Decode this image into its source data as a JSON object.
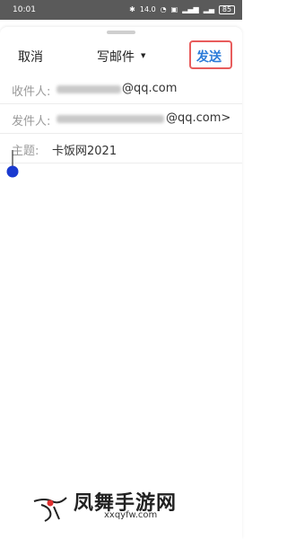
{
  "status_bar": {
    "time": "10:01",
    "icons": [
      "bluetooth-icon",
      "data-speed-icon",
      "wifi-icon",
      "hd-icon",
      "signal-icon",
      "signal-icon",
      "battery-icon"
    ],
    "speed": "14.0",
    "battery": "85"
  },
  "header": {
    "cancel_label": "取消",
    "title": "写邮件",
    "send_label": "发送"
  },
  "fields": {
    "recipient": {
      "label": "收件人:",
      "suffix": "@qq.com"
    },
    "sender": {
      "label": "发件人:",
      "suffix": "@qq.com>"
    },
    "subject": {
      "label": "主题:",
      "value": "卡饭网2021"
    }
  },
  "watermark": {
    "name": "凤舞手游网",
    "url": "xxqyfw.com"
  },
  "colors": {
    "accent": "#2a7ad8",
    "highlight": "#e85c5c",
    "cursor": "#1a3ad0"
  }
}
